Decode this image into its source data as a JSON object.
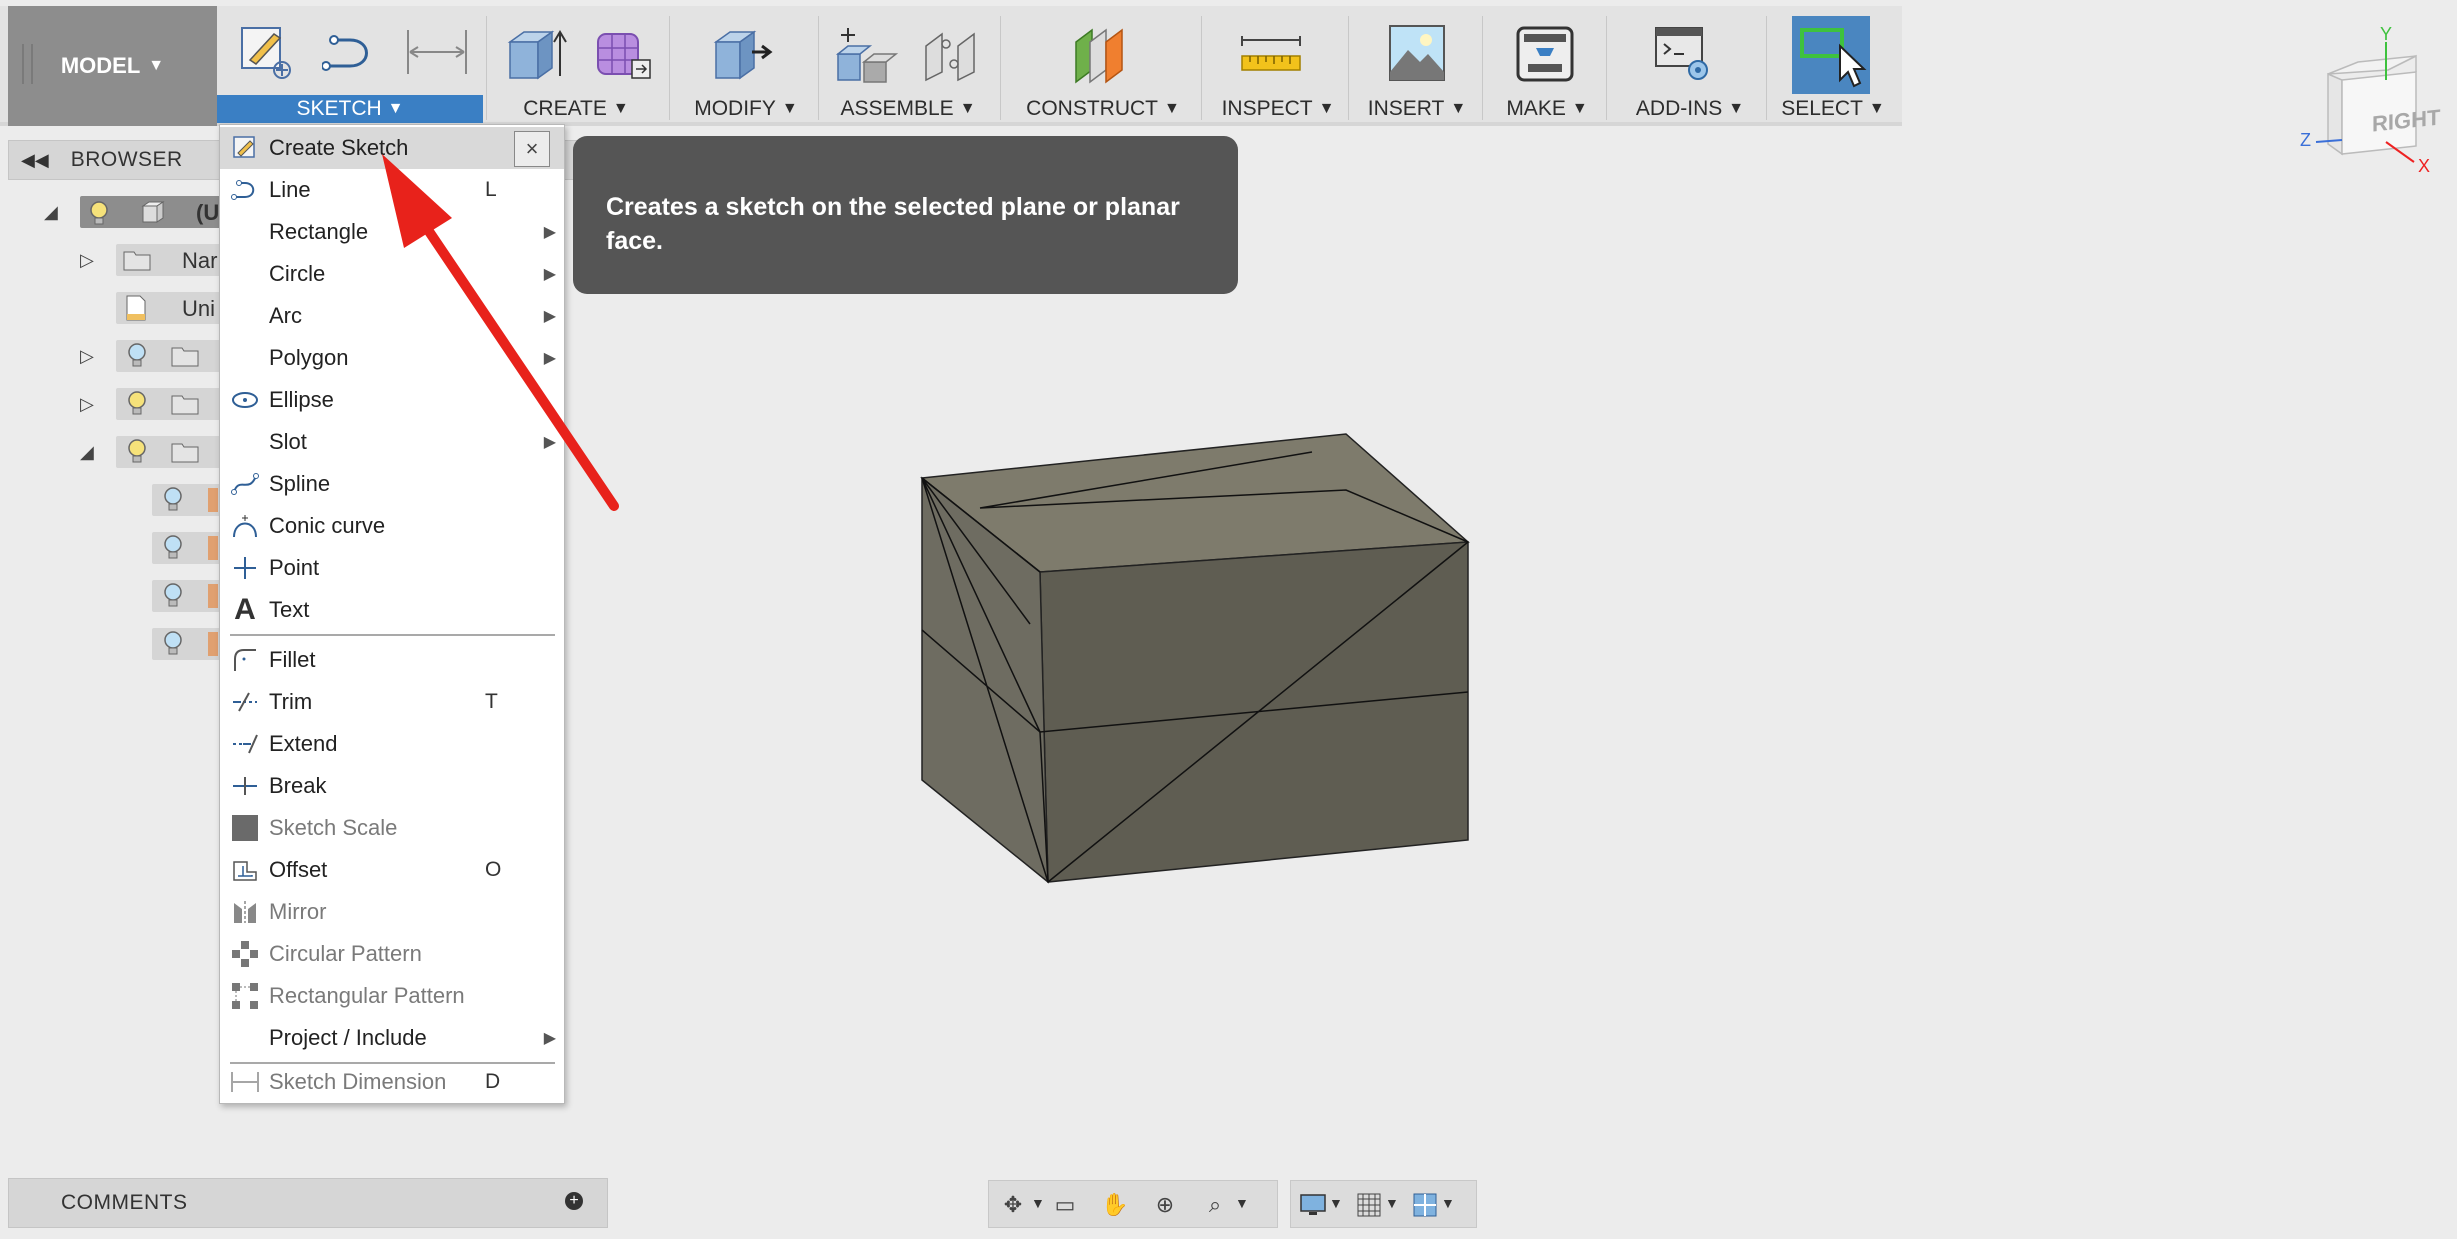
{
  "toolbar": {
    "model_label": "MODEL",
    "groups": [
      {
        "label": "SKETCH"
      },
      {
        "label": "CREATE"
      },
      {
        "label": "MODIFY"
      },
      {
        "label": "ASSEMBLE"
      },
      {
        "label": "CONSTRUCT"
      },
      {
        "label": "INSPECT"
      },
      {
        "label": "INSERT"
      },
      {
        "label": "MAKE"
      },
      {
        "label": "ADD-INS"
      },
      {
        "label": "SELECT"
      }
    ],
    "caret": "▼"
  },
  "browser": {
    "title": "BROWSER",
    "rows": [
      {
        "label": "(U"
      },
      {
        "label": "Nar"
      },
      {
        "label": "Uni"
      }
    ]
  },
  "sketch_menu": {
    "items": [
      {
        "label": "Create Sketch",
        "shortcut": "",
        "submenu": false,
        "disabled": false
      },
      {
        "label": "Line",
        "shortcut": "L",
        "submenu": false,
        "disabled": false
      },
      {
        "label": "Rectangle",
        "shortcut": "",
        "submenu": true,
        "disabled": false
      },
      {
        "label": "Circle",
        "shortcut": "",
        "submenu": true,
        "disabled": false
      },
      {
        "label": "Arc",
        "shortcut": "",
        "submenu": true,
        "disabled": false
      },
      {
        "label": "Polygon",
        "shortcut": "",
        "submenu": true,
        "disabled": false
      },
      {
        "label": "Ellipse",
        "shortcut": "",
        "submenu": false,
        "disabled": false
      },
      {
        "label": "Slot",
        "shortcut": "",
        "submenu": true,
        "disabled": false
      },
      {
        "label": "Spline",
        "shortcut": "",
        "submenu": false,
        "disabled": false
      },
      {
        "label": "Conic curve",
        "shortcut": "",
        "submenu": false,
        "disabled": false
      },
      {
        "label": "Point",
        "shortcut": "",
        "submenu": false,
        "disabled": false
      },
      {
        "label": "Text",
        "shortcut": "",
        "submenu": false,
        "disabled": false
      },
      {
        "label": "Fillet",
        "shortcut": "",
        "submenu": false,
        "disabled": false
      },
      {
        "label": "Trim",
        "shortcut": "T",
        "submenu": false,
        "disabled": false
      },
      {
        "label": "Extend",
        "shortcut": "",
        "submenu": false,
        "disabled": false
      },
      {
        "label": "Break",
        "shortcut": "",
        "submenu": false,
        "disabled": false
      },
      {
        "label": "Sketch Scale",
        "shortcut": "",
        "submenu": false,
        "disabled": true
      },
      {
        "label": "Offset",
        "shortcut": "O",
        "submenu": false,
        "disabled": false
      },
      {
        "label": "Mirror",
        "shortcut": "",
        "submenu": false,
        "disabled": true
      },
      {
        "label": "Circular Pattern",
        "shortcut": "",
        "submenu": false,
        "disabled": true
      },
      {
        "label": "Rectangular Pattern",
        "shortcut": "",
        "submenu": false,
        "disabled": true
      },
      {
        "label": "Project / Include",
        "shortcut": "",
        "submenu": true,
        "disabled": false
      },
      {
        "label": "Sketch Dimension",
        "shortcut": "D",
        "submenu": false,
        "disabled": true
      }
    ],
    "close_glyph": "×",
    "submenu_glyph": "▶"
  },
  "tooltip": {
    "text": "Creates a sketch on the selected plane or planar face."
  },
  "viewcube": {
    "face_label": "RIGHT",
    "axis_x": "X",
    "axis_y": "Y",
    "axis_z": "Z"
  },
  "comments": {
    "title": "COMMENTS"
  },
  "colors": {
    "accent": "#3a7fc4",
    "arrow": "#e8221b",
    "tooltip_bg": "#555555",
    "box_top": "#7e7b6c",
    "box_front": "#5f5d52",
    "box_side": "#6d6b60"
  }
}
